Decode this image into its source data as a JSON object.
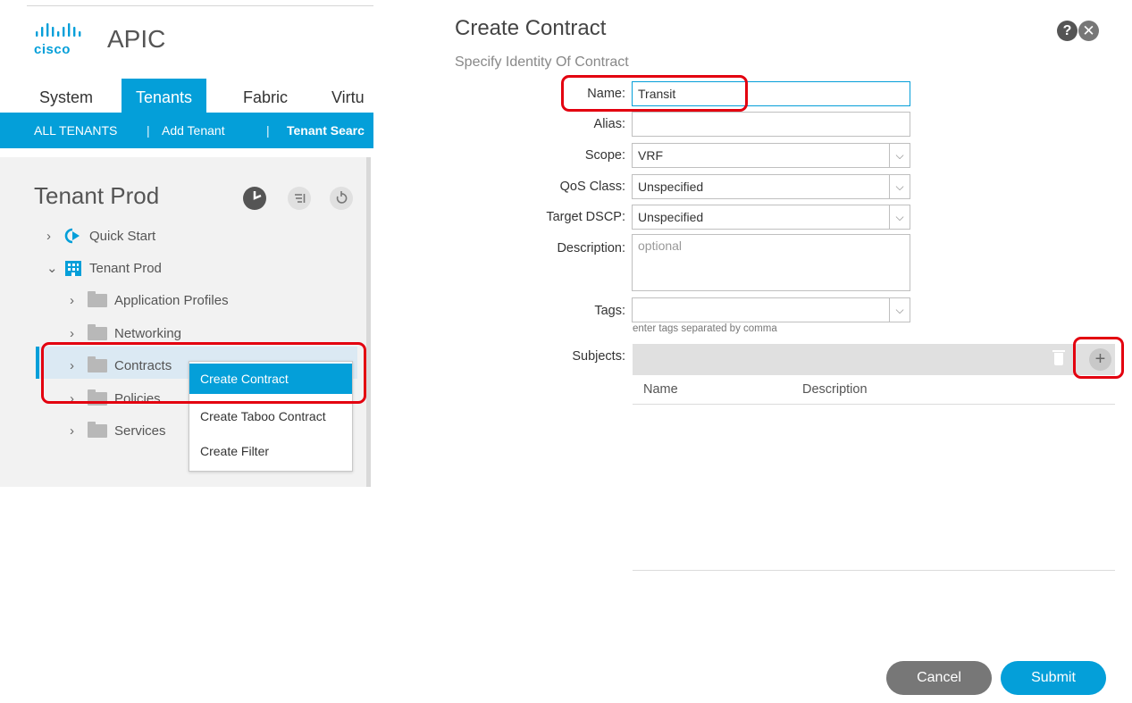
{
  "app": {
    "logo_text": "cisco",
    "title": "APIC"
  },
  "tabs": [
    {
      "label": "System"
    },
    {
      "label": "Tenants",
      "active": true
    },
    {
      "label": "Fabric"
    },
    {
      "label": "Virtu"
    }
  ],
  "subnav": {
    "all_tenants": "ALL TENANTS",
    "sep": "|",
    "add_tenant": "Add Tenant",
    "tenant_search": "Tenant Searc"
  },
  "tree": {
    "title": "Tenant Prod",
    "tools": [
      "overview-icon",
      "list-icon",
      "refresh-icon"
    ],
    "items": [
      {
        "label": "Quick Start",
        "icon": "quick-start-icon"
      },
      {
        "label": "Tenant Prod",
        "icon": "tenant-building-icon"
      },
      {
        "label": "Application Profiles",
        "icon": "folder-icon"
      },
      {
        "label": "Networking",
        "icon": "folder-icon"
      },
      {
        "label": "Contracts",
        "icon": "folder-icon",
        "selected": true
      },
      {
        "label": "Policies",
        "icon": "folder-icon"
      },
      {
        "label": "Services",
        "icon": "folder-icon"
      }
    ]
  },
  "context_menu": {
    "items": [
      {
        "label": "Create Contract",
        "active": true
      },
      {
        "label": "Create Taboo Contract"
      },
      {
        "label": "Create Filter"
      }
    ]
  },
  "dialog": {
    "title": "Create Contract",
    "subtitle": "Specify Identity Of Contract",
    "fields": {
      "name": {
        "label": "Name:",
        "value": "Transit"
      },
      "alias": {
        "label": "Alias:",
        "value": ""
      },
      "scope": {
        "label": "Scope:",
        "value": "VRF"
      },
      "qos": {
        "label": "QoS Class:",
        "value": "Unspecified"
      },
      "dscp": {
        "label": "Target DSCP:",
        "value": "Unspecified"
      },
      "description": {
        "label": "Description:",
        "placeholder": "optional"
      },
      "tags": {
        "label": "Tags:",
        "value": "",
        "hint": "enter tags separated by comma"
      }
    },
    "subjects": {
      "label": "Subjects:",
      "columns": [
        "Name",
        "Description"
      ]
    },
    "buttons": {
      "cancel": "Cancel",
      "submit": "Submit"
    }
  },
  "colors": {
    "accent": "#049fd9",
    "highlight": "#e3000f"
  }
}
